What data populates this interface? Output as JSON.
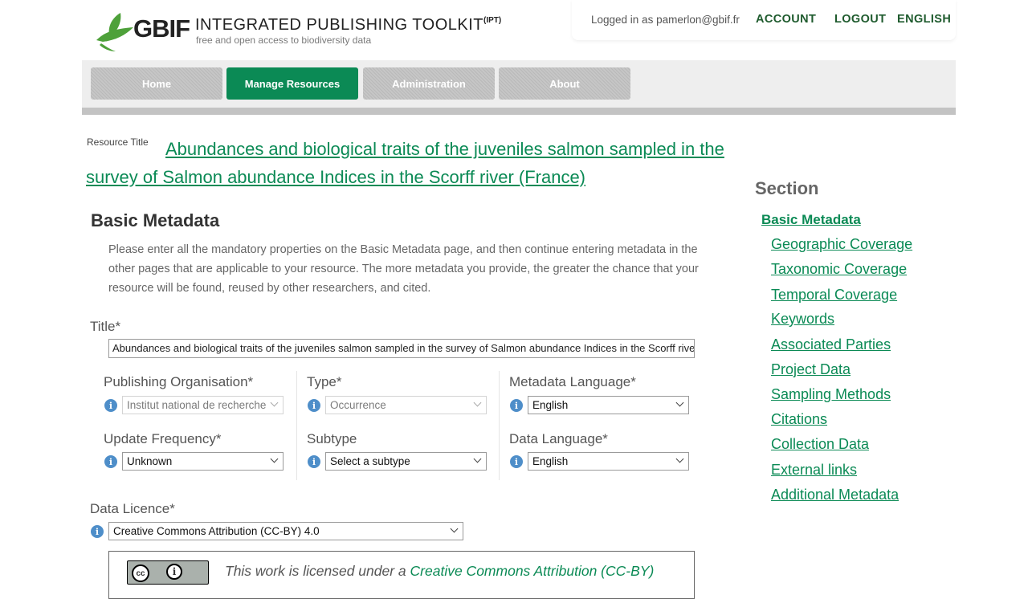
{
  "header": {
    "logo_text": "GBIF",
    "app_name": "INTEGRATED PUBLISHING TOOLKIT",
    "app_abbr": "(IPT)",
    "tagline": "free and open access to biodiversity data",
    "logged_in": "Logged in as pamerlon@gbif.fr",
    "account": "ACCOUNT",
    "logout": "LOGOUT",
    "language": "ENGLISH"
  },
  "nav": [
    {
      "label": "Home"
    },
    {
      "label": "Manage Resources"
    },
    {
      "label": "Administration"
    },
    {
      "label": "About"
    }
  ],
  "resource": {
    "title_label": "Resource Title",
    "title": "Abundances and biological traits of the juveniles salmon sampled in the survey of Salmon abundance Indices in the Scorff river (France)"
  },
  "basic": {
    "heading": "Basic Metadata",
    "intro": "Please enter all the mandatory properties on the Basic Metadata page, and then continue entering metadata in the other pages that are applicable to your resource. The more metadata you provide, the greater the chance that your resource will be found, reused by other researchers, and cited.",
    "title_label": "Title*",
    "title_value": "Abundances and biological traits of the juveniles salmon sampled in the survey of Salmon abundance Indices in the Scorff river (France)"
  },
  "fields": {
    "pub_org": {
      "label": "Publishing Organisation*",
      "value": "Institut national de recherche"
    },
    "type": {
      "label": "Type*",
      "value": "Occurrence"
    },
    "meta_lang": {
      "label": "Metadata Language*",
      "value": "English"
    },
    "update_freq": {
      "label": "Update Frequency*",
      "value": "Unknown"
    },
    "subtype": {
      "label": "Subtype",
      "value": "Select a subtype"
    },
    "data_lang": {
      "label": "Data Language*",
      "value": "English"
    }
  },
  "licence": {
    "label": "Data Licence*",
    "value": "Creative Commons Attribution (CC-BY) 4.0",
    "text_prefix": "This work is licensed under a ",
    "text_link": "Creative Commons Attribution (CC-BY)",
    "badge_cc": "cc",
    "badge_by": "i"
  },
  "sidebar": {
    "heading": "Section",
    "items": [
      {
        "label": "Basic Metadata"
      },
      {
        "label": "Geographic Coverage"
      },
      {
        "label": "Taxonomic Coverage"
      },
      {
        "label": "Temporal Coverage"
      },
      {
        "label": "Keywords"
      },
      {
        "label": "Associated Parties"
      },
      {
        "label": "Project Data"
      },
      {
        "label": "Sampling Methods"
      },
      {
        "label": "Citations"
      },
      {
        "label": "Collection Data"
      },
      {
        "label": "External links"
      },
      {
        "label": "Additional Metadata"
      }
    ]
  },
  "colors": {
    "accent": "#0b8a55",
    "info": "#4e8ec9",
    "nav_inactive": "#bfbfbf"
  },
  "icons": {
    "info": "info-circle-icon",
    "dropdown": "chevron-down-icon",
    "leaf": "gbif-leaf-logo"
  }
}
